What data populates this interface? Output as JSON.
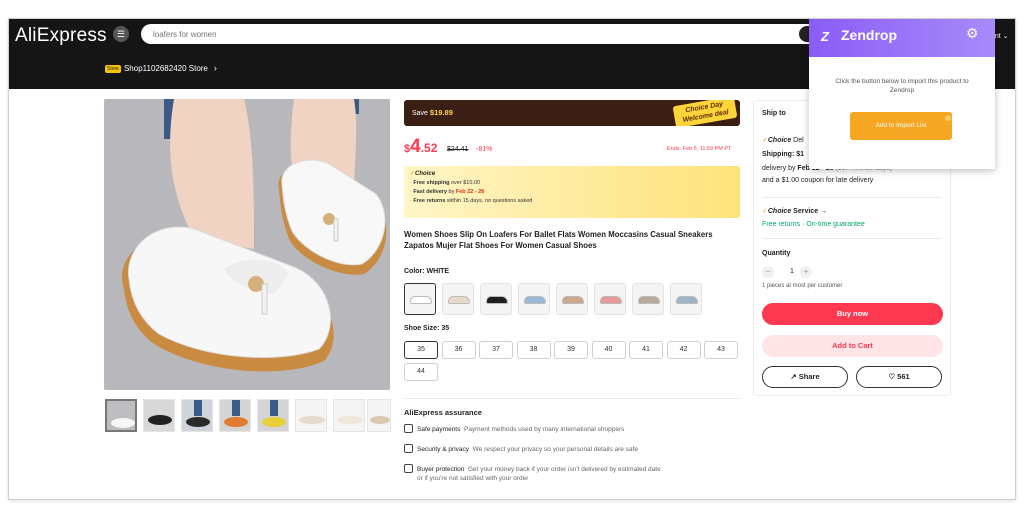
{
  "header": {
    "logo": "AliExpress",
    "search_placeholder": "loafers for women",
    "account_line1": "ᴇ",
    "account_line2": "unt ⌄",
    "store_badge": "Store",
    "store_name": "Shop1102682420 Store",
    "store_chevron": "›"
  },
  "promo": {
    "save_label": "Save",
    "save_amount": "$19.89",
    "choice_line1": "Choice Day",
    "choice_line2": "Welcome deal"
  },
  "price": {
    "currency": "$",
    "whole": "4",
    "cents": ".52",
    "original": "$24.41",
    "discount": "-81%",
    "ends": "Ends: Feb 5, 11:59 PM PT"
  },
  "choice_box": {
    "heading": "Choice",
    "line1_prefix": "Free shipping",
    "line1_suffix": "over $10.00",
    "line2_prefix": "Fast delivery",
    "line2_mid": "by",
    "line2_dates": "Feb 22 - 26",
    "line3_prefix": "Free returns",
    "line3_suffix": "within 15 days, no questions asked"
  },
  "product": {
    "title": "Women Shoes Slip On Loafers For Ballet Flats Women Moccasins Casual Sneakers Zapatos Mujer Flat Shoes For Women Casual Shoes",
    "color_label": "Color: WHITE",
    "size_label": "Shoe Size: 35",
    "sizes": [
      "35",
      "36",
      "37",
      "38",
      "39",
      "40",
      "41",
      "42",
      "43",
      "44"
    ],
    "swatch_colors": [
      "#ffffff",
      "#e8d9c4",
      "#1f1f1f",
      "#9ab8d8",
      "#c9a98a",
      "#e89a9a",
      "#b9a999",
      "#9fb5c6"
    ]
  },
  "assurance": {
    "heading": "AliExpress assurance",
    "item1_title": "Safe payments",
    "item1_desc": "Payment methods used by many international shoppers",
    "item2_title": "Security & privacy",
    "item2_desc": "We respect your privacy so your personal details are safe",
    "item3_title": "Buyer protection",
    "item3_desc": "Get your money back if your order isn't delivered by estimated date",
    "item3_desc2": "or if you're not satisfied with your order"
  },
  "sidebar": {
    "ship_to": "Ship to",
    "choice_del": "Choice",
    "choice_del_suffix": "Del",
    "shipping": "Shipping: $1",
    "delivery_prefix": "delivery by",
    "delivery_dates": "Feb 22 - 26",
    "delivery_faded": "(91.4% ≥ 20 days)",
    "coupon": "and a $1.00 coupon for late delivery",
    "choice_service": "Choice",
    "choice_service_suffix": "Service →",
    "returns": "Free returns · On-time guarantee",
    "quantity_label": "Quantity",
    "qty_minus": "−",
    "qty_value": "1",
    "qty_plus": "+",
    "limit": "1 pieces at most per customer",
    "buy_now": "Buy now",
    "add_to_cart": "Add to Cart",
    "share": "Share",
    "wishlist_count": "561"
  },
  "zendrop": {
    "title": "Zendrop",
    "message": "Click the button below to import this product to Zendrop",
    "button": "Add to Import List"
  },
  "colors": {
    "accent_red": "#fd384f",
    "zendrop_purple": "#8b5cf6",
    "zendrop_orange": "#f5a623",
    "header_black": "#151515"
  },
  "icons": [
    "menu-icon",
    "search-icon",
    "store-chevron-icon",
    "zendrop-logo-icon",
    "gear-icon",
    "shield-icon",
    "lock-icon",
    "protection-icon",
    "share-icon",
    "heart-icon"
  ]
}
